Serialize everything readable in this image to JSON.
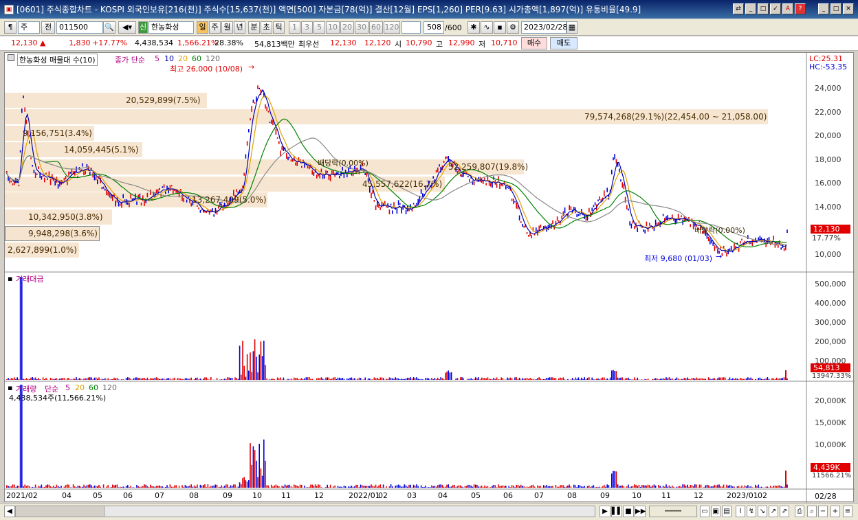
{
  "window": {
    "title": "[0601] 주식종합차트 - KOSPI 외국인보유[216(천)] 주식수[15,637(천)] 액면[500] 자본금[78(억)] 결산[12월] EPS[1,260] PER[9.63] 시가총액[1,897(억)] 유통비율[49.9]"
  },
  "toolbar": {
    "type_main": "주",
    "type_sel": "전",
    "code": "011500",
    "badge": "신",
    "name": "한농화성",
    "day_btn": "일",
    "week_btn": "주",
    "month_btn": "월",
    "year_btn": "년",
    "min_btn": "분",
    "sec_btn": "초",
    "tick_btn": "틱",
    "period_btns": [
      "1",
      "3",
      "5",
      "10",
      "20",
      "30",
      "60",
      "120"
    ],
    "count": "508",
    "count_total": "/600",
    "date": "2023/02/28"
  },
  "quote": {
    "price": "12,130",
    "arrow": "▲",
    "change": "1,830",
    "rate": "+17.77%",
    "volume": "4,438,534",
    "vol_rate": "1,566.21%",
    "turnover": "28.38%",
    "amount": "54,813백만",
    "pref_label": "최우선",
    "ask": "12,130",
    "bid": "12,120",
    "open_label": "시",
    "open": "10,790",
    "high_label": "고",
    "high": "12,990",
    "low_label": "저",
    "low": "10,710",
    "buy_btn": "매수",
    "sell_btn": "매도"
  },
  "price_panel": {
    "legend_name": "한농화성 매물대 수(10)",
    "ma_label": "종가 단순",
    "ma_periods": [
      "5",
      "10",
      "20",
      "60",
      "120"
    ],
    "lc": "LC:25.31",
    "hc": "HC:-53.35",
    "high_note": "최고 26,000 (10/08)",
    "low_note": "최저 9,680 (01/03)",
    "div1": "배당락(0.00%)",
    "div2": "배당락(0.00%)",
    "current": "12,130",
    "current_rate": "17.77%",
    "yticks": [
      "24,000",
      "22,000",
      "20,000",
      "18,000",
      "16,000",
      "14,000",
      "12,000",
      "10,000"
    ],
    "profile": [
      "79,574,268(29.1%)(22,454.00 ~ 21,058.00)",
      "20,529,899(7.5%)",
      "9,156,751(3.4%)",
      "14,059,445(5.1%)",
      "52,259,807(19.8%)",
      "45,557,622(16.7%)",
      "13,267,409(5.0%)",
      "10,342,950(3.8%)",
      "9,948,298(3.6%)",
      "2,627,899(1.0%)"
    ]
  },
  "amount_panel": {
    "label": "거래대금",
    "yticks": [
      "500,000",
      "400,000",
      "300,000",
      "200,000",
      "100,000"
    ],
    "current": "54,813",
    "current_rate": "13947.33%"
  },
  "volume_panel": {
    "label": "거래량",
    "ma_label": "단순",
    "ma_periods": [
      "5",
      "20",
      "60",
      "120"
    ],
    "info": "4,438,534주(11,566.21%)",
    "yticks": [
      "20,000K",
      "15,000K",
      "10,000K",
      "5,000K"
    ],
    "current": "4,439K",
    "current_rate": "11566.21%"
  },
  "xaxis": {
    "labels": [
      "2021/02",
      "04",
      "05",
      "06",
      "07",
      "08",
      "09",
      "10",
      "11",
      "12",
      "2022/01",
      "02",
      "03",
      "04",
      "05",
      "06",
      "07",
      "08",
      "09",
      "10",
      "11",
      "12",
      "2023/01",
      "02"
    ],
    "last": "02/28"
  },
  "colors": {
    "up": "#e00000",
    "down": "#0000e0",
    "band": "#f5e3cc"
  }
}
